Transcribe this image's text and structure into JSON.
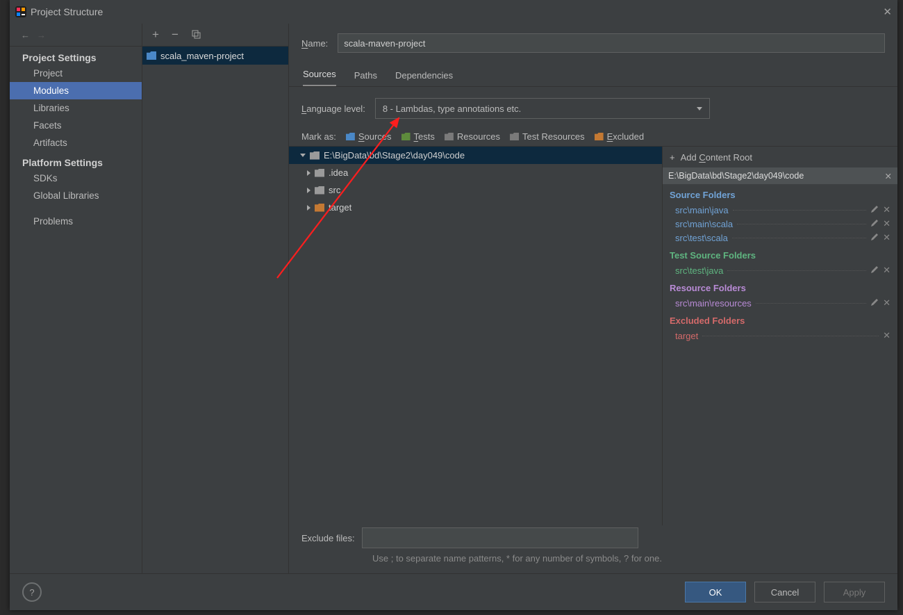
{
  "title": "Project Structure",
  "sidebar": {
    "groups": [
      {
        "label": "Project Settings",
        "items": [
          "Project",
          "Modules",
          "Libraries",
          "Facets",
          "Artifacts"
        ],
        "selected": 1
      },
      {
        "label": "Platform Settings",
        "items": [
          "SDKs",
          "Global Libraries"
        ]
      },
      {
        "label": "",
        "items": [
          "Problems"
        ]
      }
    ]
  },
  "module_tree": {
    "selected": "scala_maven-project",
    "label": "scala_maven-project"
  },
  "name_label": "Name:",
  "name_value": "scala-maven-project",
  "tabs": {
    "items": [
      "Sources",
      "Paths",
      "Dependencies"
    ],
    "selected": 0
  },
  "language_level_label": "Language level:",
  "language_level_value": "8 - Lambdas, type annotations etc.",
  "mark_as_label": "Mark as:",
  "mark_as": [
    "Sources",
    "Tests",
    "Resources",
    "Test Resources",
    "Excluded"
  ],
  "filetree": {
    "root": "E:\\BigData\\bd\\Stage2\\day049\\code",
    "children": [
      {
        "label": ".idea",
        "color": "gray"
      },
      {
        "label": "src",
        "color": "gray"
      },
      {
        "label": "target",
        "color": "orange"
      }
    ]
  },
  "add_content_root": "Add Content Root",
  "content_root_header": "E:\\BigData\\bd\\Stage2\\day049\\code",
  "folder_groups": {
    "source": {
      "title": "Source Folders",
      "items": [
        "src\\main\\java",
        "src\\main\\scala",
        "src\\test\\scala"
      ]
    },
    "test": {
      "title": "Test Source Folders",
      "items": [
        "src\\test\\java"
      ]
    },
    "resource": {
      "title": "Resource Folders",
      "items": [
        "src\\main\\resources"
      ]
    },
    "excluded": {
      "title": "Excluded Folders",
      "items": [
        "target"
      ]
    }
  },
  "exclude_files_label": "Exclude files:",
  "exclude_hint": "Use ; to separate name patterns, * for any number of symbols, ? for one.",
  "buttons": {
    "ok": "OK",
    "cancel": "Cancel",
    "apply": "Apply"
  }
}
